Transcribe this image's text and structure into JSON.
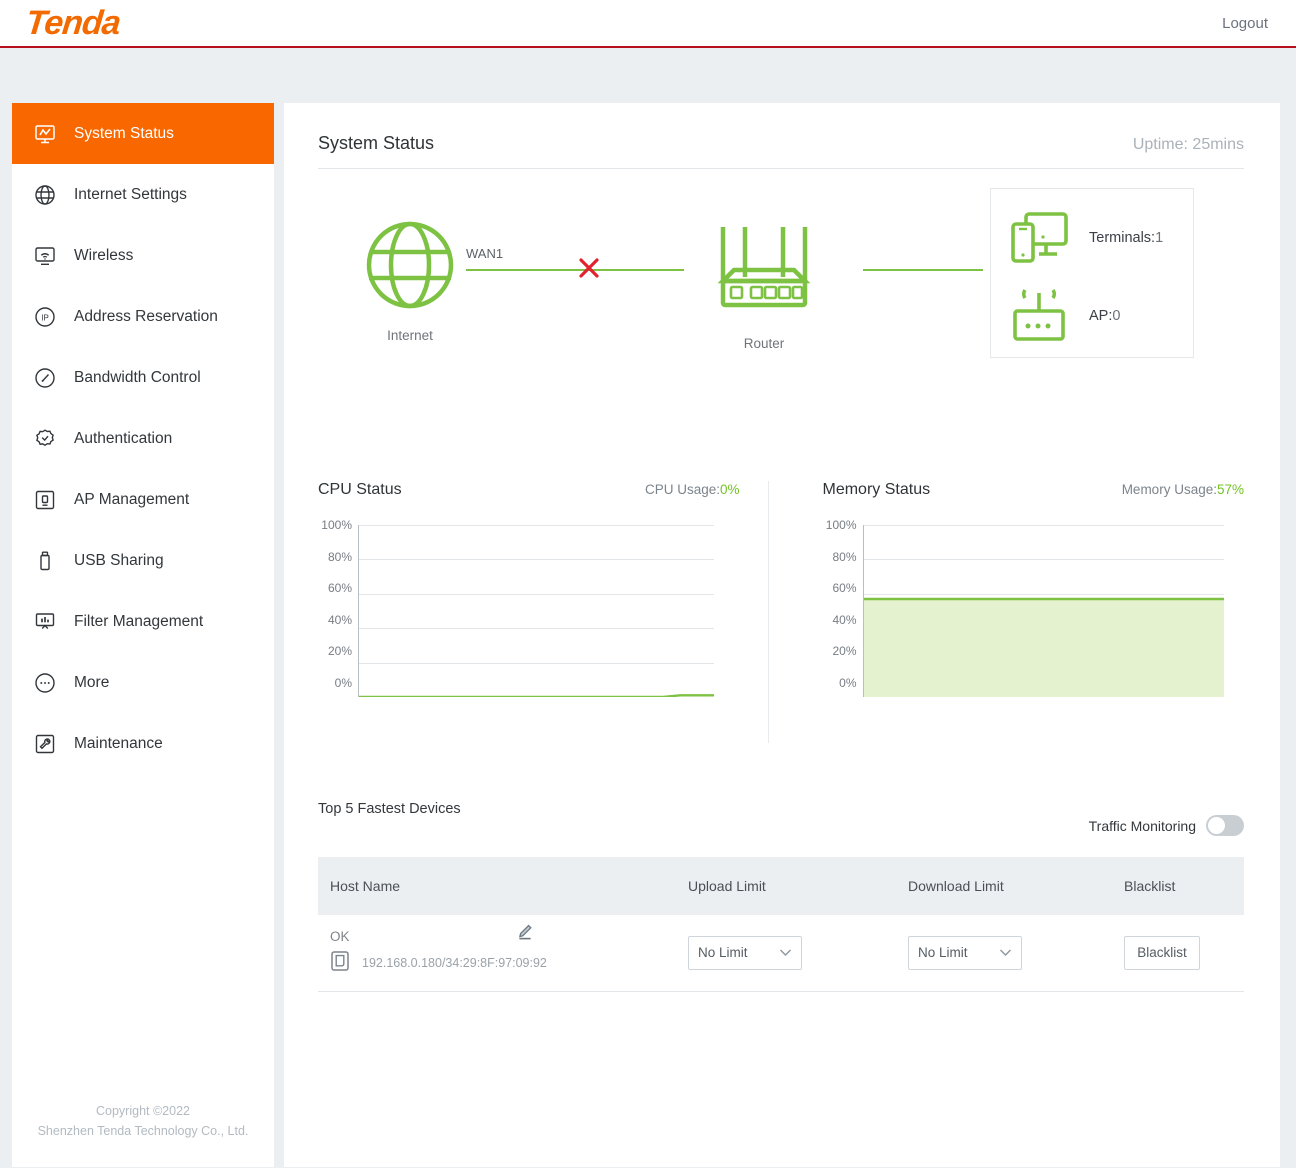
{
  "header": {
    "brand": "Tenda",
    "logout_label": "Logout"
  },
  "sidebar": {
    "items": [
      {
        "label": "System Status",
        "icon": "system-status-icon",
        "active": true
      },
      {
        "label": "Internet Settings",
        "icon": "globe-icon",
        "active": false
      },
      {
        "label": "Wireless",
        "icon": "wireless-icon",
        "active": false
      },
      {
        "label": "Address Reservation",
        "icon": "ip-circle-icon",
        "active": false
      },
      {
        "label": "Bandwidth Control",
        "icon": "gauge-icon",
        "active": false
      },
      {
        "label": "Authentication",
        "icon": "badge-check-icon",
        "active": false
      },
      {
        "label": "AP Management",
        "icon": "ap-management-icon",
        "active": false
      },
      {
        "label": "USB Sharing",
        "icon": "usb-icon",
        "active": false
      },
      {
        "label": "Filter Management",
        "icon": "filter-chart-icon",
        "active": false
      },
      {
        "label": "More",
        "icon": "ellipsis-circle-icon",
        "active": false
      },
      {
        "label": "Maintenance",
        "icon": "wrench-icon",
        "active": false
      }
    ],
    "copyright_line1": "Copyright ©2022",
    "copyright_line2": "Shenzhen Tenda Technology Co., Ltd."
  },
  "main": {
    "page_title": "System Status",
    "uptime": "Uptime: 25mins"
  },
  "topology": {
    "internet_label": "Internet",
    "router_label": "Router",
    "wan_label": "WAN1",
    "wan_status": "disconnected",
    "terminals_label": "Terminals:",
    "terminals_value": "1",
    "ap_label": "AP:",
    "ap_value": "0",
    "link_color": "#7dc242",
    "error_color": "#e0232e",
    "icon_color": "#7dc242"
  },
  "chart_data": [
    {
      "type": "line",
      "title": "CPU Status",
      "usage_label": "CPU Usage:",
      "usage_value": "0%",
      "ylabel": "",
      "xlabel": "",
      "ylim": [
        0,
        100
      ],
      "yticks": [
        "100%",
        "80%",
        "60%",
        "40%",
        "20%",
        "0%"
      ],
      "grid": true,
      "legend": "none",
      "series": [
        {
          "name": "CPU Usage",
          "values": [
            0,
            0,
            0,
            0,
            0,
            0,
            0,
            0,
            0,
            0,
            0,
            0,
            0,
            0,
            0,
            0,
            0,
            0,
            0,
            1,
            1,
            1
          ]
        }
      ],
      "line_color": "#7dc242",
      "fill_color": "none"
    },
    {
      "type": "area",
      "title": "Memory Status",
      "usage_label": "Memory Usage:",
      "usage_value": "57%",
      "ylabel": "",
      "xlabel": "",
      "ylim": [
        0,
        100
      ],
      "yticks": [
        "100%",
        "80%",
        "60%",
        "40%",
        "20%",
        "0%"
      ],
      "grid": true,
      "legend": "none",
      "series": [
        {
          "name": "Memory Usage",
          "values": [
            57,
            57,
            57,
            57,
            57,
            57,
            57,
            57,
            57,
            57,
            57,
            57,
            57,
            57,
            57,
            57,
            57,
            57,
            57,
            57,
            57,
            57
          ]
        }
      ],
      "line_color": "#7dc242",
      "fill_color": "#e4f2cf"
    }
  ],
  "devices": {
    "section_title": "Top 5 Fastest Devices",
    "traffic_monitoring_label": "Traffic Monitoring",
    "traffic_monitoring_on": false,
    "columns": [
      "Host Name",
      "Upload Limit",
      "Download Limit",
      "Blacklist"
    ],
    "rows": [
      {
        "host_name": "OK",
        "ip_mac": "192.168.0.180/34:29:8F:97:09:92",
        "upload_limit": "No Limit",
        "download_limit": "No Limit",
        "blacklist_label": "Blacklist"
      }
    ]
  }
}
